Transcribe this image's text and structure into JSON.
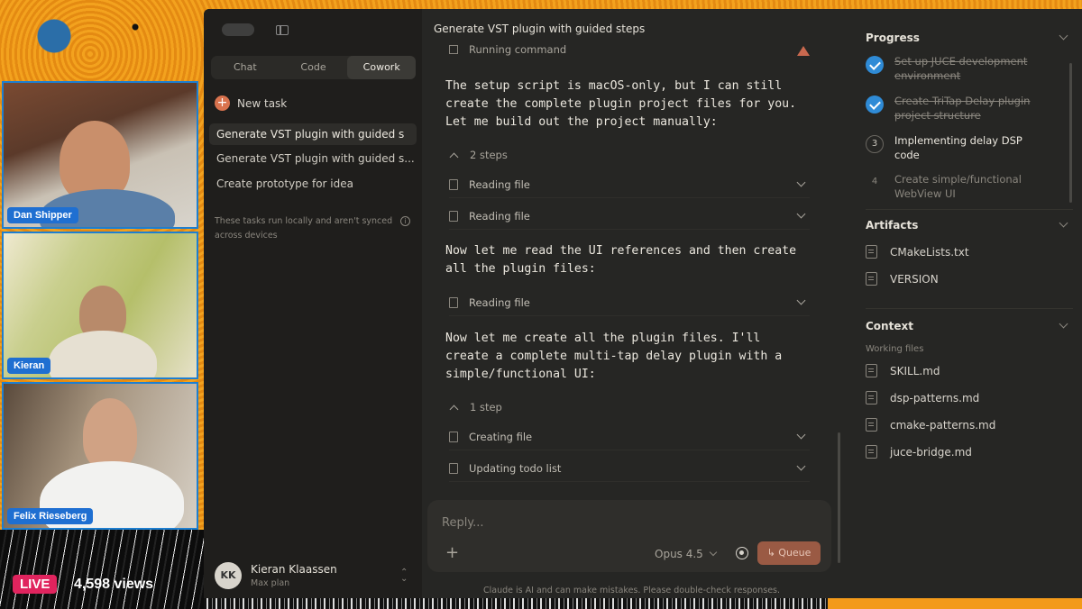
{
  "stream": {
    "participants": [
      "Dan Shipper",
      "Kieran",
      "Felix Rieseberg"
    ],
    "live_label": "LIVE",
    "views": "4,598 views"
  },
  "sidebar": {
    "tabs": [
      "Chat",
      "Code",
      "Cowork"
    ],
    "active_tab": "Cowork",
    "new_task": "New task",
    "tasks": [
      "Generate VST plugin with guided s",
      "Generate VST plugin with guided s...",
      "Create prototype for idea"
    ],
    "sync_note": "These tasks run locally and aren't synced across devices",
    "user": {
      "initials": "KK",
      "name": "Kieran Klaassen",
      "plan": "Max plan"
    }
  },
  "chat": {
    "title": "Generate VST plugin with guided steps",
    "running": "Running command",
    "messages": [
      "The setup script is macOS-only, but I can still create the complete plugin project files for you. Let me build out the project manually:",
      "Now let me read the UI references and then create all the plugin files:",
      "Now let me create all the plugin files. I'll create a complete multi-tap delay plugin with a simple/functional UI:"
    ],
    "group1": "2 steps",
    "group2": "1 step",
    "steps": {
      "read1": "Reading file",
      "read2": "Reading file",
      "read3": "Reading file",
      "create": "Creating file",
      "todo": "Updating todo list"
    },
    "composer": {
      "placeholder": "Reply...",
      "model": "Opus 4.5",
      "queue": "Queue"
    },
    "disclaimer": "Claude is AI and can make mistakes. Please double-check responses."
  },
  "right": {
    "progress_title": "Progress",
    "progress": [
      {
        "state": "done",
        "label": "Set up JUCE development environment"
      },
      {
        "state": "done",
        "label": "Create TriTap Delay plugin project structure"
      },
      {
        "state": "current",
        "num": "3",
        "label": "Implementing delay DSP code"
      },
      {
        "state": "pending",
        "num": "4",
        "label": "Create simple/functional WebView UI"
      }
    ],
    "artifacts_title": "Artifacts",
    "artifacts": [
      "CMakeLists.txt",
      "VERSION"
    ],
    "context_title": "Context",
    "working_files_label": "Working files",
    "working_files": [
      "SKILL.md",
      "dsp-patterns.md",
      "cmake-patterns.md",
      "juce-bridge.md"
    ]
  },
  "colors": {
    "accent_blue": "#2f8bd6",
    "live_red": "#e0245e",
    "queue": "#9a5a44"
  }
}
